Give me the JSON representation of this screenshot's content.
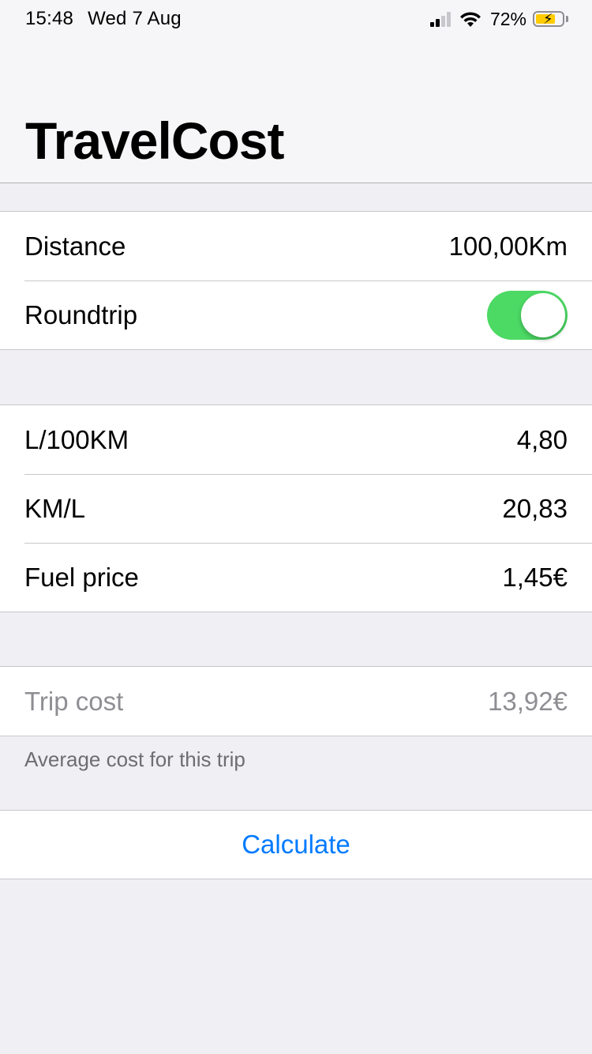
{
  "status_bar": {
    "time": "15:48",
    "date": "Wed 7 Aug",
    "battery_percent": "72%",
    "signal_bars": 2,
    "battery_level": 0.72,
    "charging": true
  },
  "nav": {
    "title": "TravelCost"
  },
  "trip": {
    "distance_label": "Distance",
    "distance_value": "100,00Km",
    "roundtrip_label": "Roundtrip",
    "roundtrip_on": true
  },
  "fuel": {
    "consumption_label": "L/100KM",
    "consumption_value": "4,80",
    "efficiency_label": "KM/L",
    "efficiency_value": "20,83",
    "price_label": "Fuel price",
    "price_value": "1,45€"
  },
  "result": {
    "cost_label": "Trip cost",
    "cost_value": "13,92€",
    "footer": "Average cost for this trip"
  },
  "actions": {
    "calculate_label": "Calculate"
  },
  "colors": {
    "toggle_on": "#4cd964",
    "tint": "#007aff",
    "battery_charging": "#ffcc00",
    "background": "#efeff4"
  }
}
